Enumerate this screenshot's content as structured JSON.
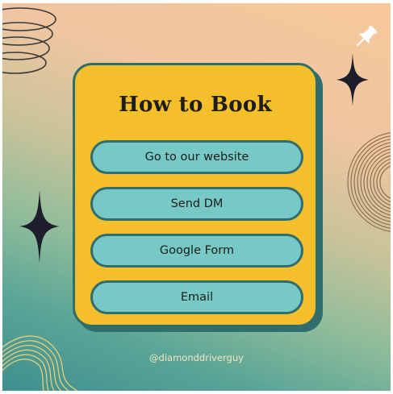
{
  "card": {
    "title": "How to Book",
    "options": [
      {
        "label": "Go to our website"
      },
      {
        "label": "Send DM"
      },
      {
        "label": "Google Form"
      },
      {
        "label": "Email"
      }
    ]
  },
  "footer": {
    "handle": "@diamonddriverguy"
  },
  "icons": [
    "swirl-decoration",
    "concentric-rings-decoration",
    "sparkle-star-icon",
    "wave-lines-decoration",
    "pin-icon"
  ],
  "colors": {
    "card": "#f4bf2b",
    "button": "#77c9c6",
    "outline": "#2f6e6c",
    "title_text": "#1d1d1b",
    "handle_text": "#f3e7c0"
  }
}
